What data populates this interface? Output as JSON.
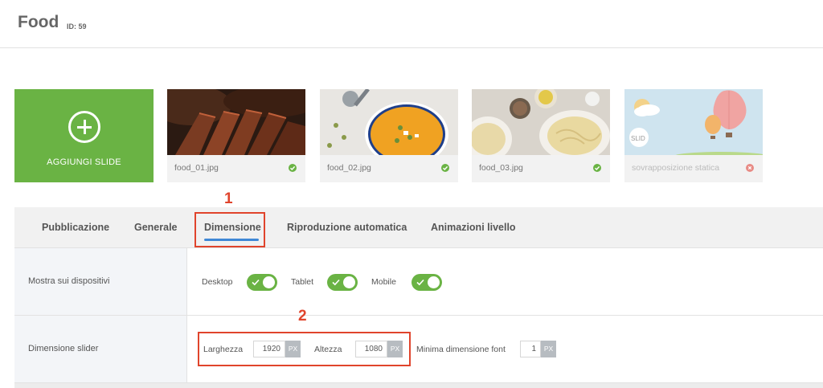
{
  "header": {
    "title": "Food",
    "id_label": "ID: 59"
  },
  "add_slide": {
    "label": "AGGIUNGI SLIDE",
    "icon": "plus-circle-icon"
  },
  "slides": [
    {
      "filename": "food_01.jpg",
      "status": "ok"
    },
    {
      "filename": "food_02.jpg",
      "status": "ok"
    },
    {
      "filename": "food_03.jpg",
      "status": "ok"
    },
    {
      "filename": "sovrapposizione statica",
      "status": "error",
      "badge": "SLID"
    }
  ],
  "tabs": [
    {
      "label": "Pubblicazione"
    },
    {
      "label": "Generale"
    },
    {
      "label": "Dimensione",
      "active": true
    },
    {
      "label": "Riproduzione automatica"
    },
    {
      "label": "Animazioni livello"
    }
  ],
  "devices_row": {
    "label": "Mostra sui dispositivi",
    "devices": [
      {
        "label": "Desktop",
        "enabled": true
      },
      {
        "label": "Tablet",
        "enabled": true
      },
      {
        "label": "Mobile",
        "enabled": true
      }
    ]
  },
  "size_row": {
    "label": "Dimensione slider",
    "width_label": "Larghezza",
    "width_value": "1920",
    "height_label": "Altezza",
    "height_value": "1080",
    "min_font_label": "Minima dimensione font",
    "min_font_value": "1",
    "unit": "PX"
  },
  "annotations": {
    "marker_1": "1",
    "marker_2": "2"
  },
  "colors": {
    "accent_green": "#6ab344",
    "tab_underline": "#3f88d6",
    "annotation_red": "#e0442c"
  }
}
